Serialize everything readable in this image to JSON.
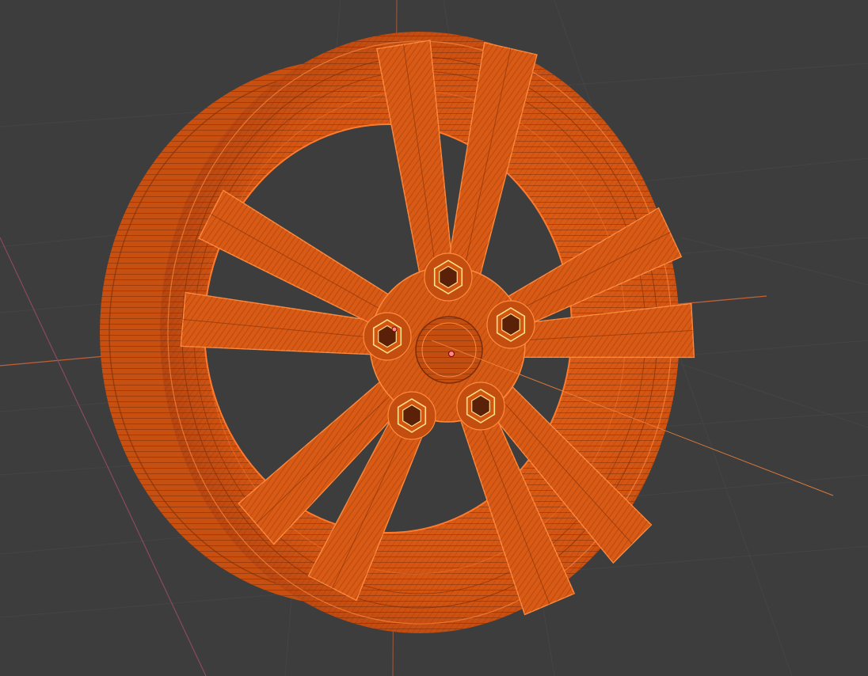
{
  "viewport": {
    "background_color": "#3d3d3d",
    "grid_color": "#4a4a4a",
    "axis_x_color": "#c0603a",
    "axis_y_color": "#8a4a5a",
    "selection_color": "#e8611c",
    "selection_dark": "#7a2e0c",
    "active_vertex_color": "#ffe28a",
    "origin_color": "#ff8a8a"
  },
  "scene": {
    "object": "wheel-rim",
    "shading_mode": "wireframe",
    "selected": true,
    "spoke_count": 10,
    "lug_nut_count": 5,
    "icons": [
      "lug-nut-icon",
      "object-origin-icon"
    ]
  }
}
